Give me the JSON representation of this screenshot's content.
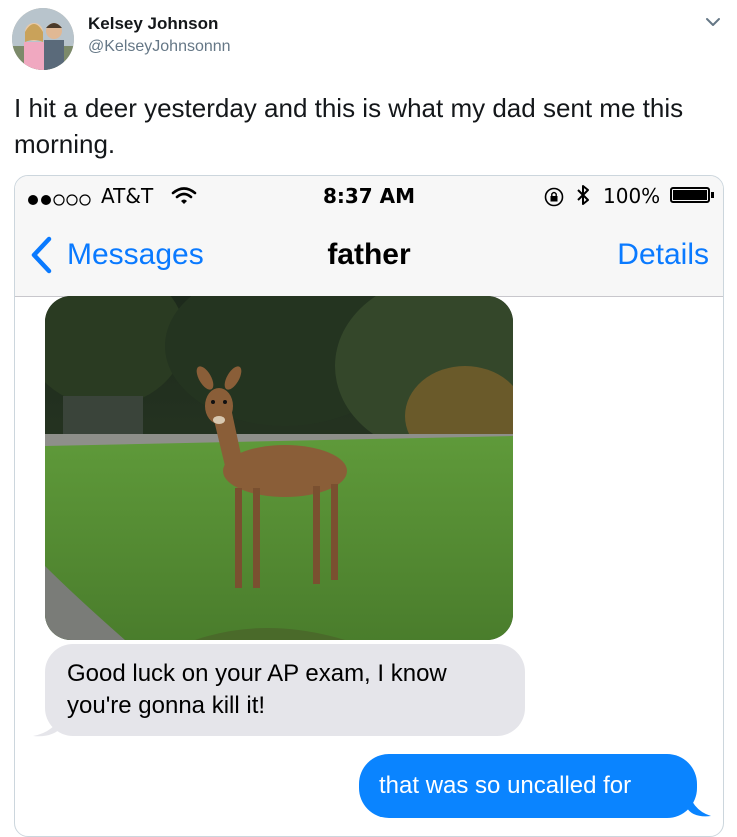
{
  "tweet": {
    "author_name": "Kelsey Johnson",
    "author_handle": "@KelseyJohnsonnn",
    "text": "I hit a deer yesterday and this is what my dad sent me this morning."
  },
  "phone": {
    "status_bar": {
      "carrier": "AT&T",
      "time": "8:37 AM",
      "battery_text": "100%",
      "battery_level": 1.0,
      "signal_bars_filled": 2,
      "signal_bars_total": 5
    },
    "nav": {
      "back_label": "Messages",
      "contact_name": "father",
      "details_label": "Details"
    },
    "messages": {
      "incoming_text": "Good luck on your AP exam, I know you're gonna kill it!",
      "outgoing_text": "that was so uncalled for"
    },
    "colors": {
      "ios_blue": "#0a7aff",
      "outgoing_bubble": "#0a84ff",
      "incoming_bubble": "#e5e5ea"
    }
  }
}
